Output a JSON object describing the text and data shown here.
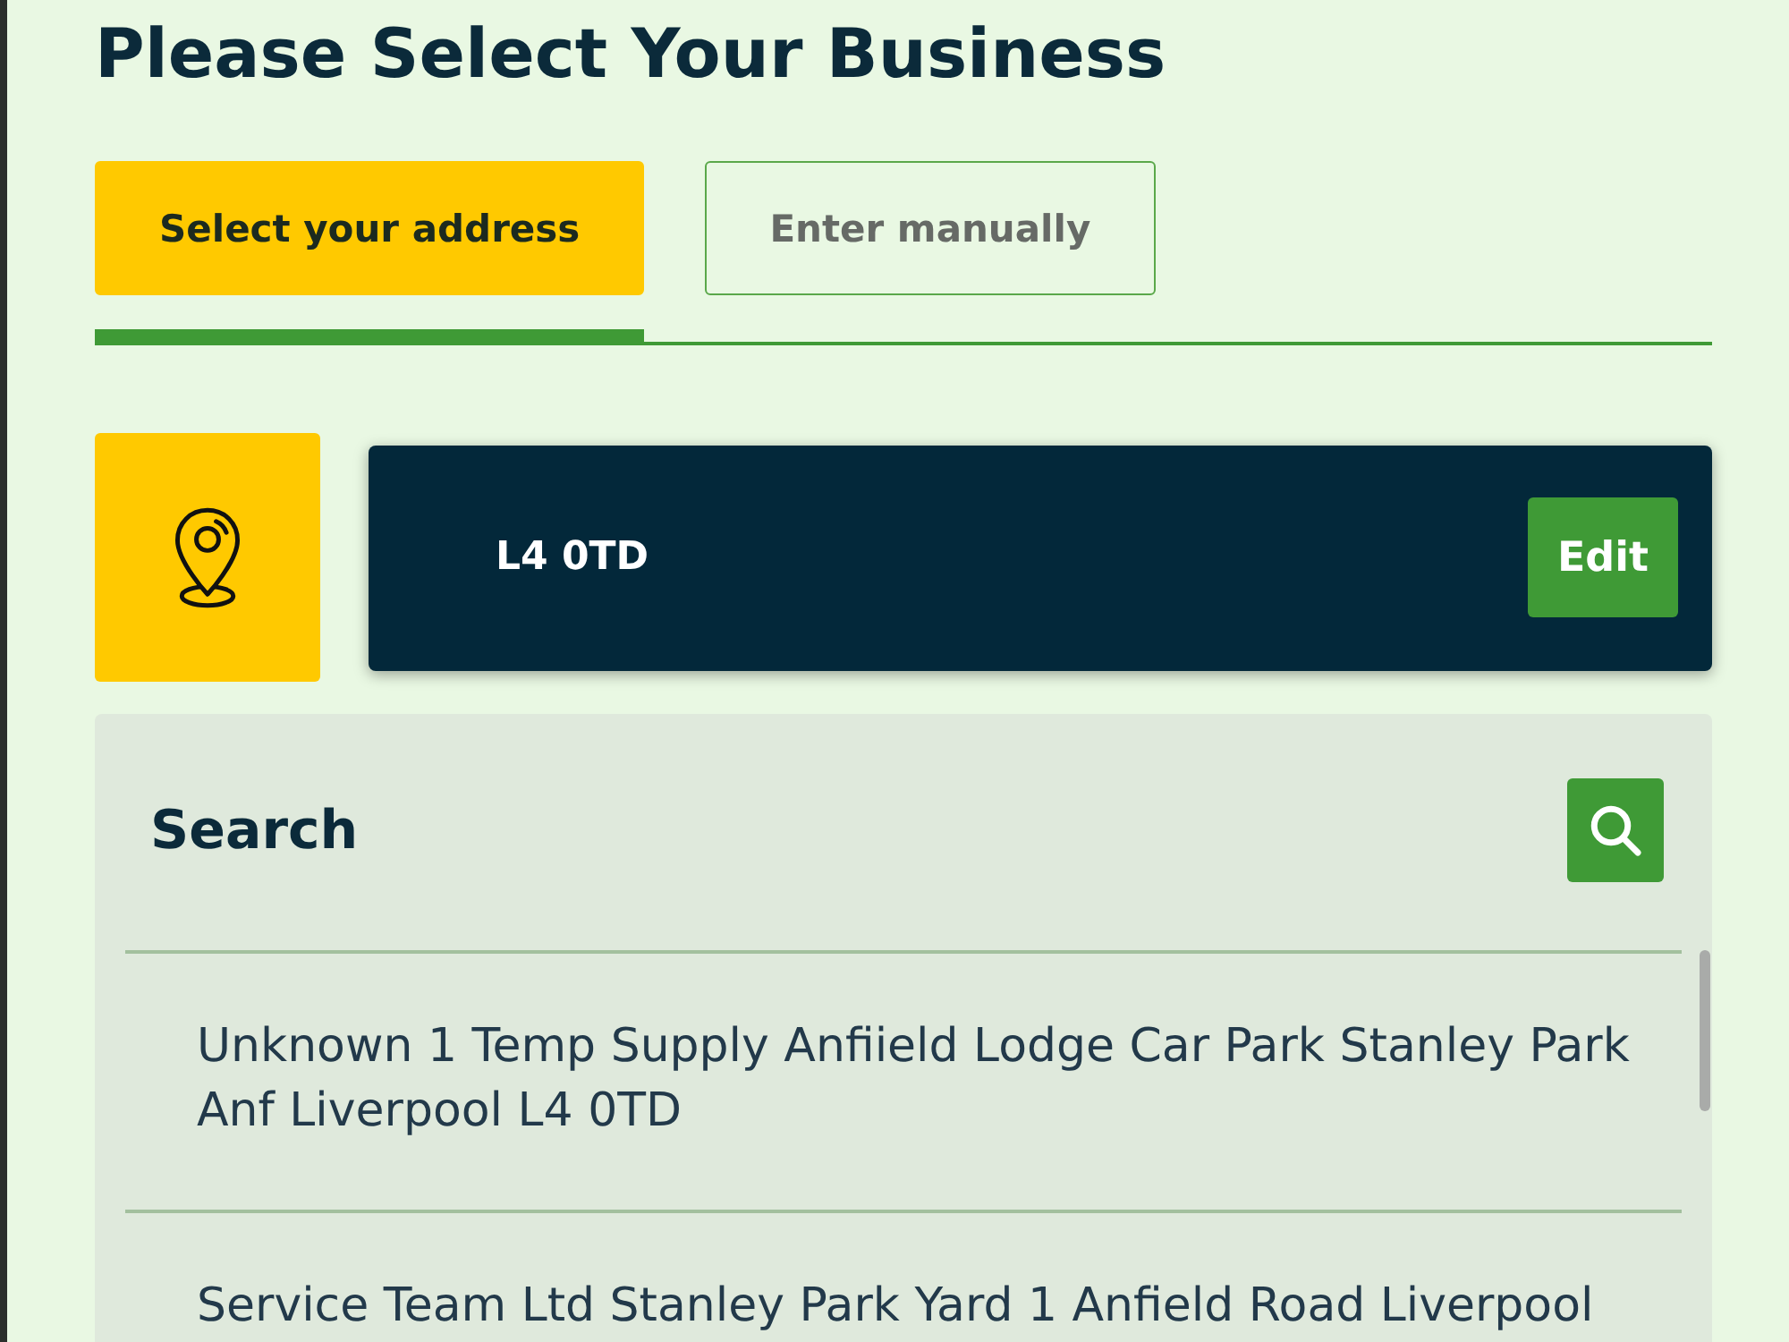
{
  "title": "Please Select Your Business",
  "tabs": [
    {
      "label": "Select your address",
      "selected": true
    },
    {
      "label": "Enter manually",
      "selected": false
    }
  ],
  "postcode": {
    "value": "L4 0TD",
    "edit_button": "Edit"
  },
  "search": {
    "label": "Search"
  },
  "results": [
    {
      "text": "Unknown 1 Temp Supply Anfiield Lodge Car Park Stanley Park Anf Liverpool L4 0TD"
    },
    {
      "text": "Service Team Ltd Stanley Park Yard 1 Anfield Road Liverpool"
    }
  ]
}
